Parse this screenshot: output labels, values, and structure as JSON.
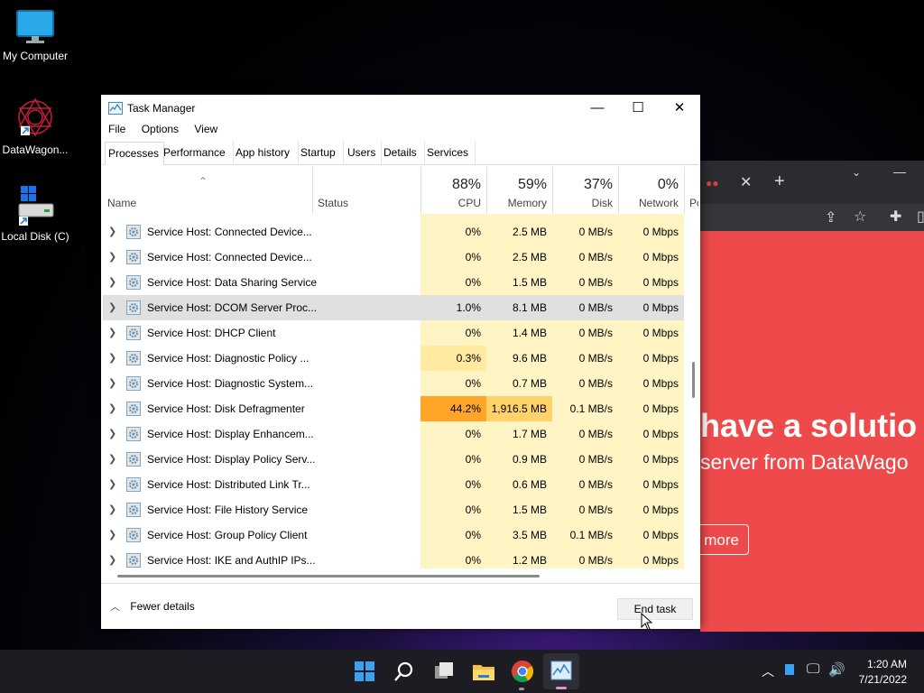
{
  "desktop": {
    "icons": [
      {
        "label": "My Computer"
      },
      {
        "label": "DataWagon..."
      },
      {
        "label": "Local Disk (C)"
      }
    ]
  },
  "browser": {
    "heading": "have a solutio",
    "subheading": "server from DataWago",
    "button": "more",
    "accent": "#ef4a4b"
  },
  "window": {
    "title": "Task Manager",
    "menu": [
      "File",
      "Options",
      "View"
    ],
    "tabs": [
      "Processes",
      "Performance",
      "App history",
      "Startup",
      "Users",
      "Details",
      "Services"
    ],
    "active_tab": "Processes",
    "columns": {
      "name": "Name",
      "status": "Status",
      "cpu": {
        "pct": "88%",
        "label": "CPU"
      },
      "memory": {
        "pct": "59%",
        "label": "Memory"
      },
      "disk": {
        "pct": "37%",
        "label": "Disk"
      },
      "network": {
        "pct": "0%",
        "label": "Network"
      },
      "power": "Po"
    },
    "rows": [
      {
        "name": "Service Host: Connected Device...",
        "cpu": "0%",
        "memory": "2.5 MB",
        "disk": "0 MB/s",
        "network": "0 Mbps",
        "cpu_heat": 0
      },
      {
        "name": "Service Host: Connected Device...",
        "cpu": "0%",
        "memory": "2.5 MB",
        "disk": "0 MB/s",
        "network": "0 Mbps",
        "cpu_heat": 0
      },
      {
        "name": "Service Host: Data Sharing Service",
        "cpu": "0%",
        "memory": "1.5 MB",
        "disk": "0 MB/s",
        "network": "0 Mbps",
        "cpu_heat": 0
      },
      {
        "name": "Service Host: DCOM Server Proc...",
        "cpu": "1.0%",
        "memory": "8.1 MB",
        "disk": "0 MB/s",
        "network": "0 Mbps",
        "cpu_heat": 1,
        "selected": true
      },
      {
        "name": "Service Host: DHCP Client",
        "cpu": "0%",
        "memory": "1.4 MB",
        "disk": "0 MB/s",
        "network": "0 Mbps",
        "cpu_heat": 0
      },
      {
        "name": "Service Host: Diagnostic Policy ...",
        "cpu": "0.3%",
        "memory": "9.6 MB",
        "disk": "0 MB/s",
        "network": "0 Mbps",
        "cpu_heat": 1
      },
      {
        "name": "Service Host: Diagnostic System...",
        "cpu": "0%",
        "memory": "0.7 MB",
        "disk": "0 MB/s",
        "network": "0 Mbps",
        "cpu_heat": 0
      },
      {
        "name": "Service Host: Disk Defragmenter",
        "cpu": "44.2%",
        "memory": "1,916.5 MB",
        "disk": "0.1 MB/s",
        "network": "0 Mbps",
        "cpu_heat": 3,
        "mem_heat": 2
      },
      {
        "name": "Service Host: Display Enhancem...",
        "cpu": "0%",
        "memory": "1.7 MB",
        "disk": "0 MB/s",
        "network": "0 Mbps",
        "cpu_heat": 0
      },
      {
        "name": "Service Host: Display Policy Serv...",
        "cpu": "0%",
        "memory": "0.9 MB",
        "disk": "0 MB/s",
        "network": "0 Mbps",
        "cpu_heat": 0
      },
      {
        "name": "Service Host: Distributed Link Tr...",
        "cpu": "0%",
        "memory": "0.6 MB",
        "disk": "0 MB/s",
        "network": "0 Mbps",
        "cpu_heat": 0
      },
      {
        "name": "Service Host: File History Service",
        "cpu": "0%",
        "memory": "1.5 MB",
        "disk": "0 MB/s",
        "network": "0 Mbps",
        "cpu_heat": 0
      },
      {
        "name": "Service Host: Group Policy Client",
        "cpu": "0%",
        "memory": "3.5 MB",
        "disk": "0.1 MB/s",
        "network": "0 Mbps",
        "cpu_heat": 0
      },
      {
        "name": "Service Host: IKE and AuthIP IPs...",
        "cpu": "0%",
        "memory": "1.2 MB",
        "disk": "0 MB/s",
        "network": "0 Mbps",
        "cpu_heat": 0
      }
    ],
    "footer": {
      "fewer_details": "Fewer details",
      "end_task": "End task"
    }
  },
  "taskbar": {
    "time": "1:20 AM",
    "date": "7/21/2022"
  },
  "colors": {
    "heat0": "#fff4c4",
    "heat1": "#ffeaa0",
    "heat2": "#ffd36a",
    "heat3": "#ffa629",
    "selected": "#e0e0e0"
  }
}
